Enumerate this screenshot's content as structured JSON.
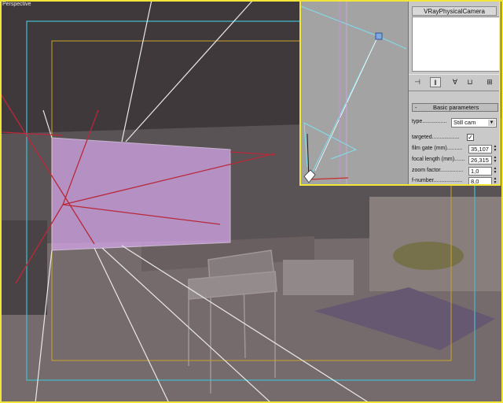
{
  "viewport": {
    "label": "Perspective",
    "frame_color": "#f2e53a",
    "safe_frame_outer_color": "#3fbfd0",
    "safe_frame_inner_color": "#c8a12a",
    "film_gate_color": "#d4a6e6"
  },
  "inset": {
    "object_name": "VRayPhysicalCamera",
    "toolbar": {
      "pin_icon": "pin-stack-icon",
      "show_end_result_icon": "show-end-result-icon",
      "make_unique_icon": "make-unique-icon",
      "remove_modifier_icon": "remove-modifier-icon",
      "configure_sets_icon": "configure-modifier-sets-icon"
    },
    "rollout": {
      "collapse_symbol": "-",
      "title": "Basic parameters"
    },
    "params": {
      "type_label": "type................",
      "type_value": "Still cam",
      "targeted_label": "targeted..................",
      "targeted_checked": true,
      "film_gate_label": "film gate (mm)..........",
      "film_gate_value": "35,107",
      "focal_length_label": "focal length (mm).......",
      "focal_length_value": "26,315",
      "zoom_factor_label": "zoom factor...............",
      "zoom_factor_value": "1,0",
      "f_number_label": "f-number...................",
      "f_number_value": "8,0"
    }
  }
}
